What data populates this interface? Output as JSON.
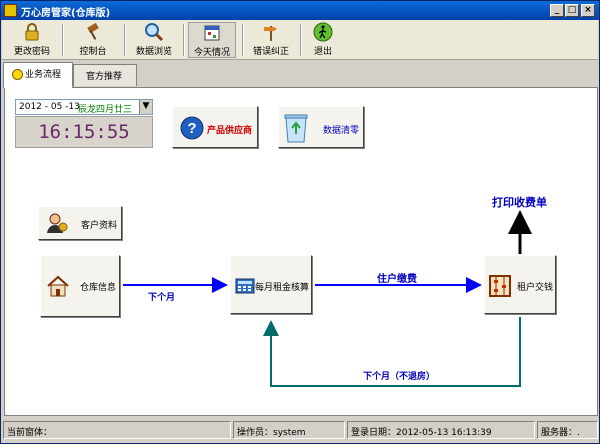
{
  "window": {
    "title": "万心房管家(仓库版)",
    "min": "_",
    "max": "□",
    "close": "×"
  },
  "toolbar": [
    {
      "label": "更改密码",
      "icon": "lock-icon"
    },
    {
      "label": "控制台",
      "icon": "gavel-icon"
    },
    {
      "label": "数据浏览",
      "icon": "magnifier-icon"
    },
    {
      "label": "今天情况",
      "icon": "calendar-icon"
    },
    {
      "label": "错误纠正",
      "icon": "signpost-icon"
    },
    {
      "label": "退出",
      "icon": "walking-man-icon"
    }
  ],
  "tabs": [
    {
      "label": "业务流程",
      "icon": "smiley-icon"
    },
    {
      "label": "官方推荐"
    }
  ],
  "date": {
    "value": "2012 - 05 -13",
    "lunar": "辰龙四月廿三"
  },
  "clock": "16:15:55",
  "buttons": {
    "supplier": "产品供应商",
    "clear_data": "数据清零",
    "customer": "客户资料",
    "warehouse": "仓库信息",
    "monthly_rent": "每月租金核算",
    "tenant_pay": "租户交钱"
  },
  "flow": {
    "next_month": "下个月",
    "tenant_pay": "住户缴费",
    "print_receipt": "打印收费单",
    "next_month_stay": "下个月（不退房）"
  },
  "colors": {
    "flow_blue": "#0000ff",
    "flow_teal": "#006c6c",
    "print_arrow": "#000000"
  },
  "status": {
    "current_window": "当前窗体：",
    "operator": "操作员：system",
    "login_date": "登录日期：2012-05-13 16:13:39",
    "server": "服务器：."
  }
}
